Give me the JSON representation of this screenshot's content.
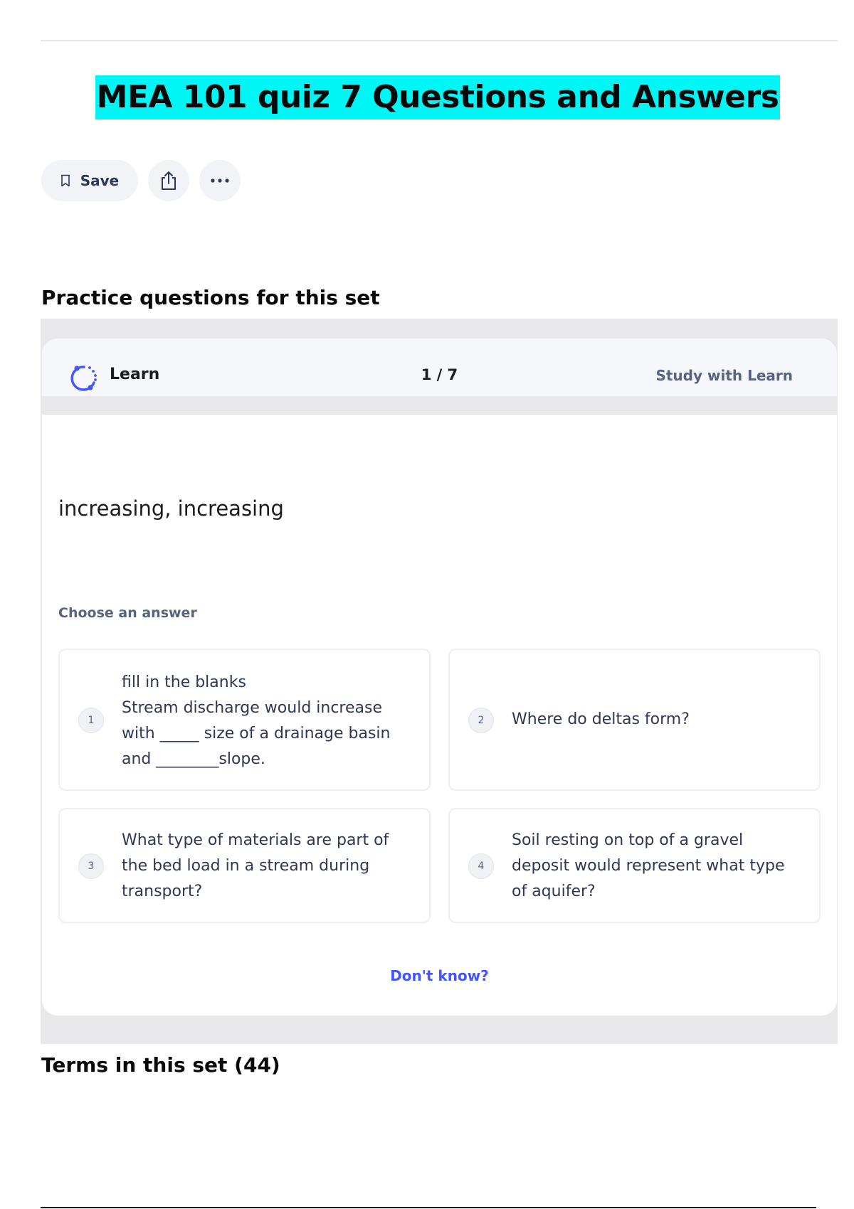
{
  "page": {
    "title": "MEA 101 quiz 7 Questions and Answers"
  },
  "actions": {
    "save_label": "Save",
    "save_icon": "bookmark-icon",
    "share_icon": "share-icon",
    "more_icon": "more-dots-icon"
  },
  "practice": {
    "heading": "Practice questions for this set",
    "learn_label": "Learn",
    "counter": "1 / 7",
    "study_link": "Study with Learn",
    "prompt": "increasing,  increasing",
    "choose_label": "Choose an answer",
    "options": [
      {
        "number": "1",
        "lines": [
          "fill in the blanks",
          "Stream discharge would increase",
          "with _____ size of a drainage basin",
          "and ________slope."
        ]
      },
      {
        "number": "2",
        "lines": [
          "Where do deltas form?"
        ]
      },
      {
        "number": "3",
        "lines": [
          "What type of materials are part of",
          "the bed load in a stream during",
          "transport?"
        ]
      },
      {
        "number": "4",
        "lines": [
          "Soil resting on top of a gravel",
          "deposit would represent what type",
          "of aquifer?"
        ]
      }
    ],
    "dont_know": "Don't know?"
  },
  "terms": {
    "heading": "Terms in this set (44)"
  },
  "colors": {
    "title_highlight": "#00f5f5",
    "accent": "#4255ff",
    "muted": "#586380"
  }
}
